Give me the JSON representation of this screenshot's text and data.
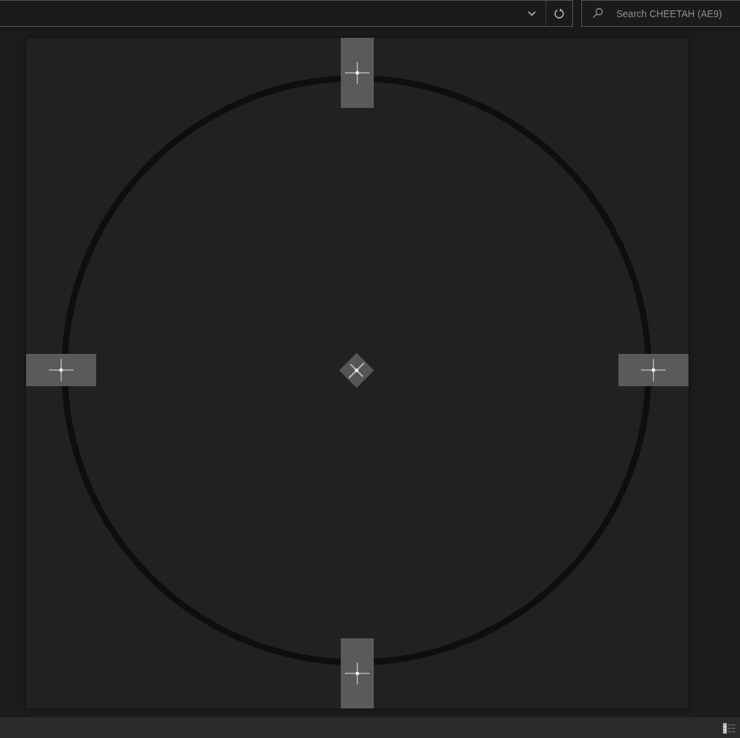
{
  "search": {
    "placeholder": "Search CHEETAH (AE9)"
  }
}
